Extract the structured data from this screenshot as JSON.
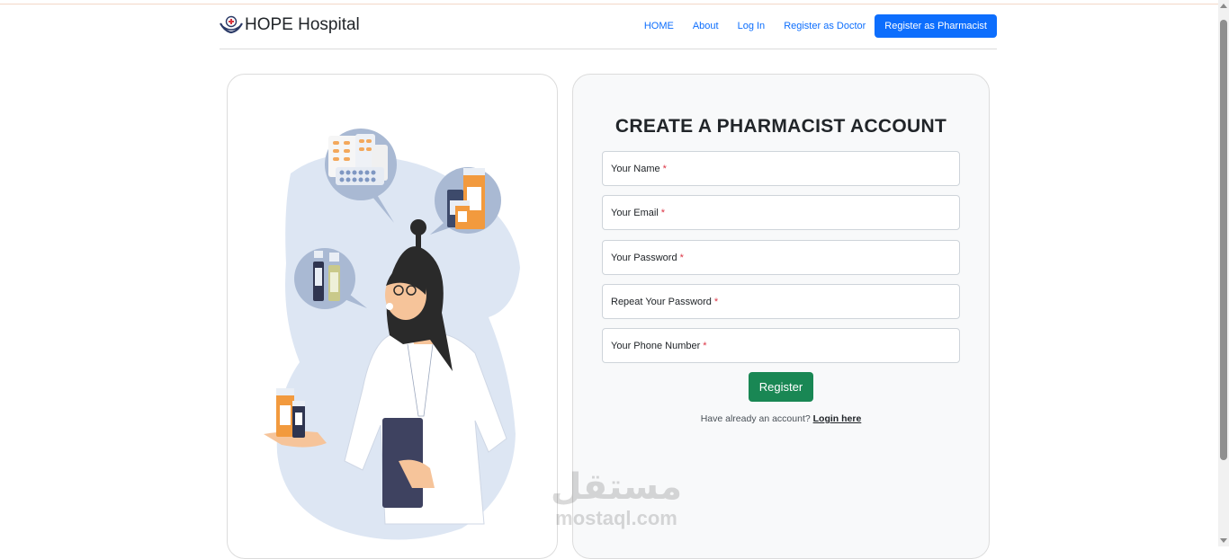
{
  "brand": {
    "name": "HOPE Hospital",
    "logo_icon": "hospital-hands-logo-icon"
  },
  "nav": {
    "links": [
      "HOME",
      "About",
      "Log In",
      "Register as Doctor"
    ],
    "active_button": "Register as Pharmacist"
  },
  "form": {
    "title": "CREATE A PHARMACIST ACCOUNT",
    "fields": [
      {
        "label": "Your Name",
        "required": "*"
      },
      {
        "label": "Your Email",
        "required": "*"
      },
      {
        "label": "Your Password",
        "required": "*"
      },
      {
        "label": "Repeat Your Password",
        "required": "*"
      },
      {
        "label": "Your Phone Number",
        "required": "*"
      }
    ],
    "submit_label": "Register",
    "login_prompt": "Have already an account?",
    "login_link": "Login here"
  },
  "watermark": {
    "arabic": "مستقل",
    "latin": "mostaql.com"
  },
  "colors": {
    "primary": "#0d6efd",
    "success": "#198754",
    "required": "#dc3545",
    "card_bg": "#f8f9fa"
  }
}
